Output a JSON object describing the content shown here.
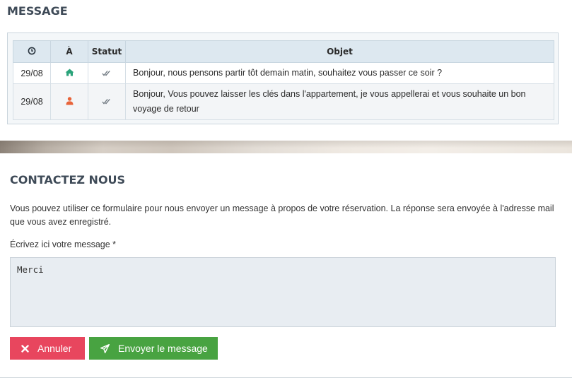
{
  "messages_section": {
    "title": "MESSAGE",
    "table": {
      "headers": {
        "date_icon": "clock-icon",
        "to": "À",
        "status": "Statut",
        "subject": "Objet"
      },
      "rows": [
        {
          "date": "29/08",
          "to_icon": "home-icon",
          "to_icon_color": "#2aa37a",
          "status_icon": "double-check-icon",
          "subject": "Bonjour, nous pensons partir tôt demain matin, souhaitez vous passer ce soir ?"
        },
        {
          "date": "29/08",
          "to_icon": "user-icon",
          "to_icon_color": "#e8643a",
          "status_icon": "double-check-icon",
          "subject": "Bonjour, Vous pouvez laisser les clés dans l'appartement, je vous appellerai et vous souhaite un bon voyage de retour"
        }
      ]
    }
  },
  "contact_section": {
    "title": "CONTACTEZ NOUS",
    "description": "Vous pouvez utiliser ce formulaire pour nous envoyer un message à propos de votre réservation. La réponse sera envoyée à l'adresse mail que vous avez enregistré.",
    "message_label": "Écrivez ici votre message  *",
    "message_value": "Merci",
    "cancel_label": "Annuler",
    "send_label": "Envoyer le message"
  },
  "colors": {
    "title": "#3e4a57",
    "table_header_bg": "#dde8f0",
    "cancel_button": "#e8465e",
    "send_button": "#48a341",
    "textarea_bg": "#e8edf2"
  }
}
